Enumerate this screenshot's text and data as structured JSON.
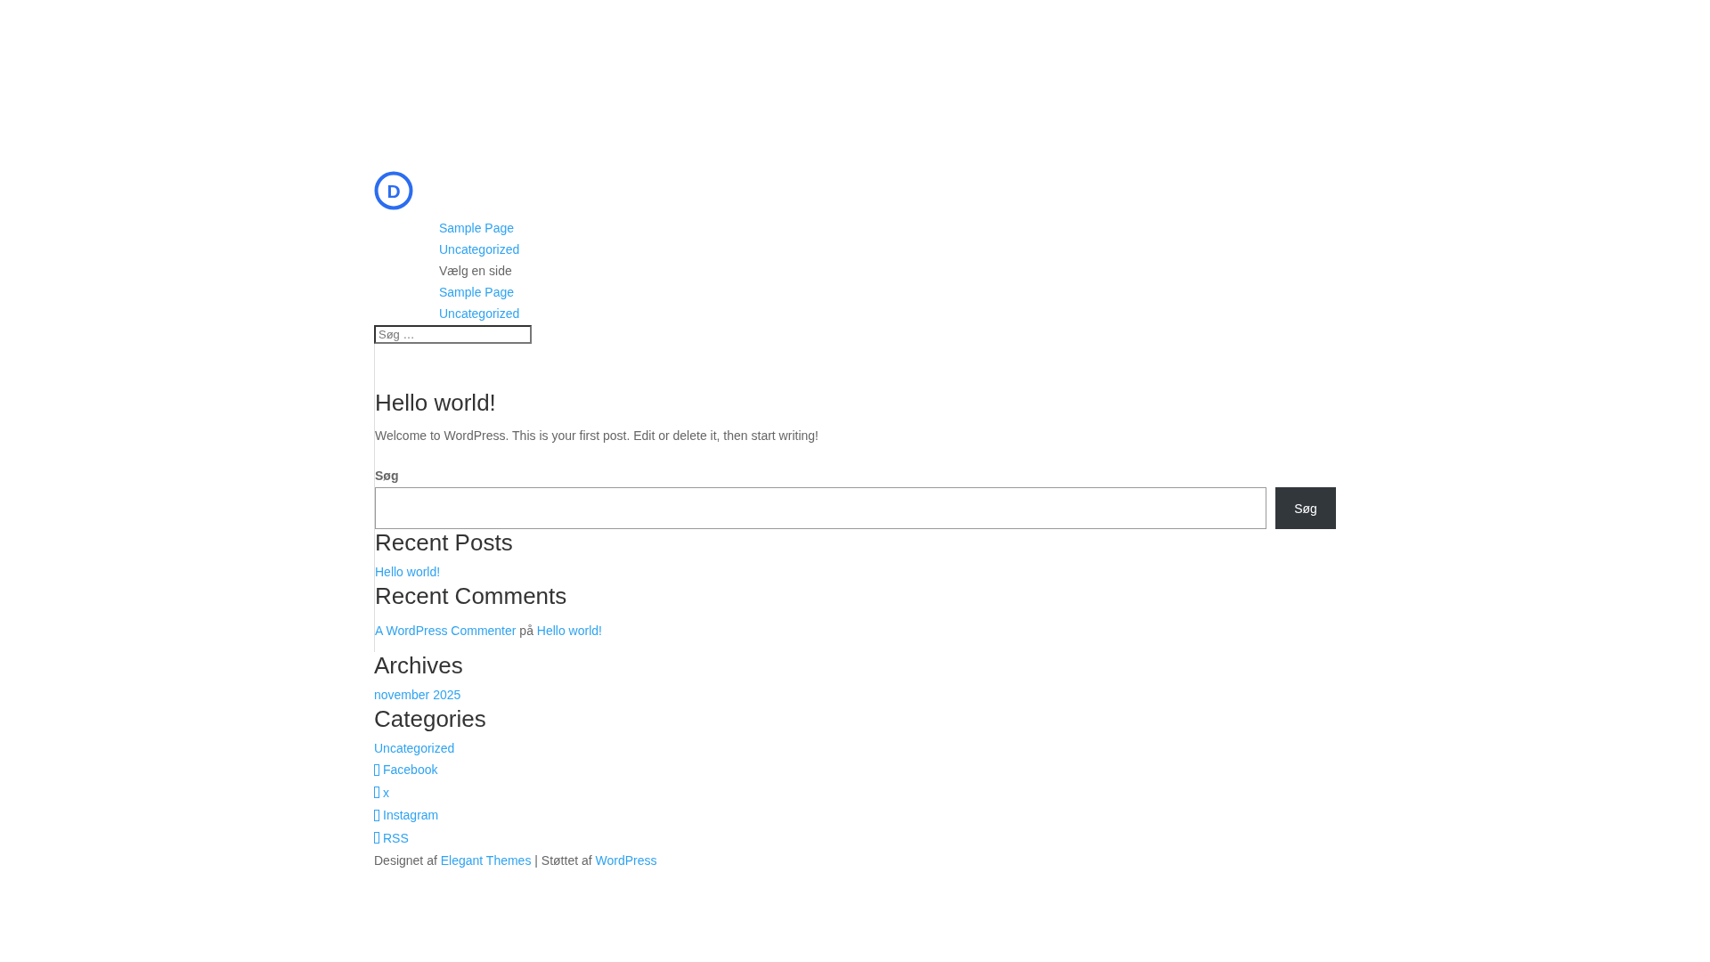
{
  "logo": {
    "letter": "D"
  },
  "menu": [
    {
      "kind": "link",
      "label": "Sample Page"
    },
    {
      "kind": "link",
      "label": "Uncategorized"
    },
    {
      "kind": "label",
      "label": "Vælg en side"
    },
    {
      "kind": "link",
      "label": "Sample Page"
    },
    {
      "kind": "link",
      "label": "Uncategorized"
    }
  ],
  "header_search": {
    "placeholder": "Søg …"
  },
  "post": {
    "title": "Hello world!",
    "excerpt": "Welcome to WordPress. This is your first post. Edit or delete it, then start writing!"
  },
  "search_widget": {
    "label": "Søg",
    "button": "Søg"
  },
  "recent_posts": {
    "title": "Recent Posts",
    "items": [
      "Hello world!"
    ]
  },
  "recent_comments": {
    "title": "Recent Comments",
    "items": [
      {
        "author": "A WordPress Commenter",
        "joiner": "på",
        "post": "Hello world!"
      }
    ]
  },
  "archives": {
    "title": "Archives",
    "items": [
      "november 2025"
    ]
  },
  "categories": {
    "title": "Categories",
    "items": [
      "Uncategorized"
    ]
  },
  "social": [
    {
      "label": "Facebook"
    },
    {
      "label": "x"
    },
    {
      "label": "Instagram"
    },
    {
      "label": "RSS"
    }
  ],
  "footer": {
    "prefix": "Designet af",
    "link_1": "Elegant Themes",
    "separator": "| Støttet af",
    "link_2": "WordPress"
  }
}
